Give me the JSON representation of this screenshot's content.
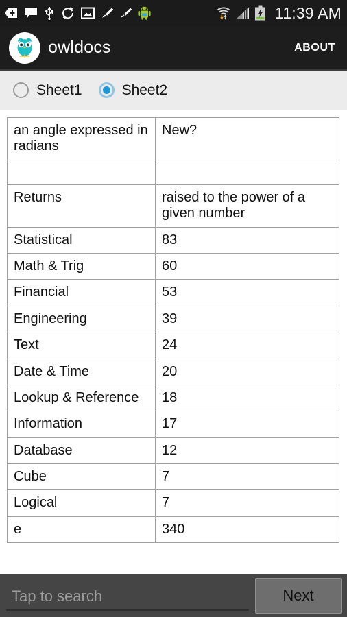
{
  "status_bar": {
    "time": "11:39 AM",
    "left_icons": [
      {
        "name": "download-arrow-icon",
        "glyph": "⬅"
      },
      {
        "name": "message-icon",
        "glyph": "💬"
      },
      {
        "name": "usb-icon",
        "glyph": "Ψ"
      },
      {
        "name": "sync-icon",
        "glyph": "↻"
      },
      {
        "name": "screenshot-image-icon",
        "glyph": "🖼"
      },
      {
        "name": "cleaner-brush-icon",
        "glyph": "🧹"
      },
      {
        "name": "cleaner-brush-2-icon",
        "glyph": "🧹"
      },
      {
        "name": "android-robot-icon",
        "glyph": "🤖"
      }
    ],
    "right_icons": [
      {
        "name": "wifi-transfer-icon"
      },
      {
        "name": "cellular-signal-icon"
      },
      {
        "name": "battery-charging-icon"
      }
    ],
    "colors": {
      "background": "#1b1b1b",
      "text": "#f2f2f2",
      "battery_green": "#8bc34a"
    }
  },
  "action_bar": {
    "app_name": "owldocs",
    "about_label": "ABOUT",
    "logo_name": "owl-logo",
    "colors": {
      "background": "#1d1d1d",
      "owl_teal": "#1fbfc6",
      "text": "#ffffff"
    }
  },
  "sheet_selector": {
    "options": [
      {
        "label": "Sheet1",
        "selected": false
      },
      {
        "label": "Sheet2",
        "selected": true
      }
    ],
    "colors": {
      "background": "#ececec",
      "selected_dot": "#1a97d4",
      "ring": "#8fc4e3"
    }
  },
  "table": {
    "rows": [
      {
        "type": "tall",
        "c0": "an angle expressed in radians",
        "c1": "New?"
      },
      {
        "type": "empty",
        "c0": "",
        "c1": ""
      },
      {
        "type": "tall",
        "c0": "Returns",
        "c1": "raised to the power of a given number"
      },
      {
        "type": "std",
        "c0": "Statistical",
        "c1": "83"
      },
      {
        "type": "std",
        "c0": "Math & Trig",
        "c1": "60"
      },
      {
        "type": "std",
        "c0": "Financial",
        "c1": "53"
      },
      {
        "type": "std",
        "c0": "Engineering",
        "c1": "39"
      },
      {
        "type": "std",
        "c0": "Text",
        "c1": "24"
      },
      {
        "type": "std",
        "c0": "Date & Time",
        "c1": "20"
      },
      {
        "type": "std",
        "c0": "Lookup & Reference",
        "c1": "18"
      },
      {
        "type": "std",
        "c0": "Information",
        "c1": "17"
      },
      {
        "type": "std",
        "c0": "Database",
        "c1": "12"
      },
      {
        "type": "std",
        "c0": "Cube",
        "c1": "7"
      },
      {
        "type": "std",
        "c0": "Logical",
        "c1": "7"
      },
      {
        "type": "std",
        "c0": "e",
        "c1": "340"
      }
    ]
  },
  "search_bar": {
    "placeholder": "Tap to search",
    "value": "",
    "next_label": "Next",
    "colors": {
      "background": "#454545",
      "placeholder": "#9a9a9a",
      "button": "#6e6e6e"
    }
  }
}
